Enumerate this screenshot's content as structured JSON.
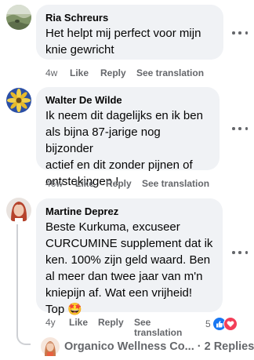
{
  "comments": [
    {
      "author": "Ria Schreurs",
      "text": "Het helpt mij perfect voor mijn\nknie gewricht",
      "time": "4w",
      "like": "Like",
      "reply": "Reply",
      "see_translation": "See translation",
      "avatar_icon": "landscape-photo-avatar"
    },
    {
      "author": "Walter De Wilde",
      "text": "Ik neem dit dagelijks en ik ben\nals bijna 87-jarige nog bijzonder\nactief en dit zonder pijnen of\nontstekingen !",
      "time": "46w",
      "like": "Like",
      "reply": "Reply",
      "see_translation": "See translation",
      "avatar_icon": "flower-photo-avatar"
    },
    {
      "author": "Martine Deprez",
      "text": "Beste Kurkuma, excuseer\nCURCUMINE supplement dat ik\nken. 100% zijn geld waard. Ben\nal meer dan twee jaar van m'n\nkniepijn af. Wat een vrijheid!\nTop 🤩",
      "time": "4y",
      "like": "Like",
      "reply": "Reply",
      "see_translation_line1": "See",
      "see_translation_line2": "translation",
      "reaction_count": "5",
      "reaction_icons": [
        "like-reaction-icon",
        "love-reaction-icon"
      ],
      "avatar_icon": "woman-portrait-avatar"
    }
  ],
  "replies_row": {
    "text": "Organico Wellness Co... · 2 Replies",
    "avatar_icon": "organico-avatar"
  },
  "colors": {
    "bubble": "#f0f2f5",
    "meta_text": "#65676b",
    "like_blue": "#1877f2",
    "love_red": "#f33e58"
  }
}
